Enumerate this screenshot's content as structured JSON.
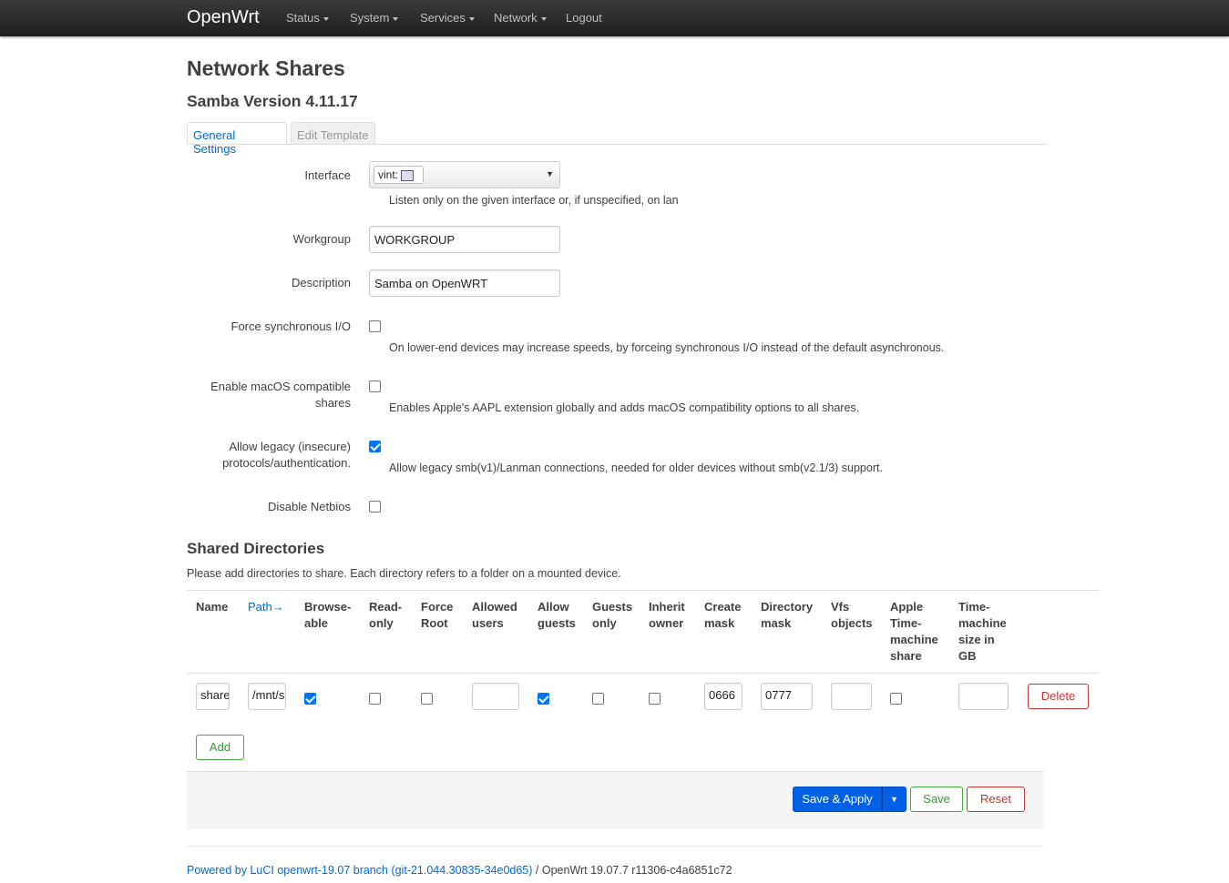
{
  "nav": {
    "brand": "OpenWrt",
    "items": [
      {
        "label": "Status",
        "dropdown": true
      },
      {
        "label": "System",
        "dropdown": true
      },
      {
        "label": "Services",
        "dropdown": true
      },
      {
        "label": "Network",
        "dropdown": true
      },
      {
        "label": "Logout",
        "dropdown": false
      }
    ]
  },
  "page": {
    "title": "Network Shares",
    "subtitle": "Samba Version 4.11.17",
    "tabs": [
      "General Settings",
      "Edit Template"
    ]
  },
  "general": {
    "interface_label": "Interface",
    "interface_value": "vint:",
    "interface_desc": "Listen only on the given interface or, if unspecified, on lan",
    "workgroup_label": "Workgroup",
    "workgroup_value": "WORKGROUP",
    "description_label": "Description",
    "description_value": "Samba on OpenWRT",
    "force_sync_label": "Force synchronous I/O",
    "force_sync_checked": false,
    "force_sync_desc": "On lower-end devices may increase speeds, by forceing synchronous I/O instead of the default asynchronous.",
    "macos_label_1": "Enable macOS compatible",
    "macos_label_2": "shares",
    "macos_checked": false,
    "macos_desc": "Enables Apple's AAPL extension globally and adds macOS compatibility options to all shares.",
    "legacy_label_1": "Allow legacy (insecure)",
    "legacy_label_2": "protocols/authentication.",
    "legacy_checked": true,
    "legacy_desc": "Allow legacy smb(v1)/Lanman connections, needed for older devices without smb(v2.1/3) support.",
    "netbios_label": "Disable Netbios",
    "netbios_checked": false
  },
  "shares": {
    "title": "Shared Directories",
    "desc": "Please add directories to share. Each directory refers to a folder on a mounted device.",
    "headers": {
      "name": "Name",
      "path": "Path→",
      "browseable": [
        "Browse-",
        "able"
      ],
      "readonly": [
        "Read-",
        "only"
      ],
      "forceroot": [
        "Force",
        "Root"
      ],
      "users": [
        "Allowed",
        "users"
      ],
      "guests": [
        "Allow",
        "guests"
      ],
      "guestsonly": [
        "Guests",
        "only"
      ],
      "inherit": [
        "Inherit",
        "owner"
      ],
      "createmask": [
        "Create",
        "mask"
      ],
      "dirmask": [
        "Directory",
        "mask"
      ],
      "vfs": [
        "Vfs",
        "objects"
      ],
      "timemachine": [
        "Apple",
        "Time-",
        "machine",
        "share"
      ],
      "tmsize": [
        "Time-",
        "machine",
        "size in",
        "GB"
      ]
    },
    "row": {
      "name": "share",
      "path": "/mnt/s",
      "browseable": true,
      "readonly": false,
      "forceroot": false,
      "users": "",
      "guests": true,
      "guestsonly": false,
      "inherit": false,
      "createmask": "0666",
      "dirmask": "0777",
      "vfs": "",
      "timemachine": false,
      "tmsize": ""
    },
    "delete_label": "Delete",
    "add_label": "Add"
  },
  "actions": {
    "save_apply": "Save & Apply",
    "save": "Save",
    "reset": "Reset"
  },
  "footer": {
    "link": "Powered by LuCI openwrt-19.07 branch (git-21.044.30835-34e0d65)",
    "version": " / OpenWrt 19.07.7 r11306-c4a6851c72"
  }
}
